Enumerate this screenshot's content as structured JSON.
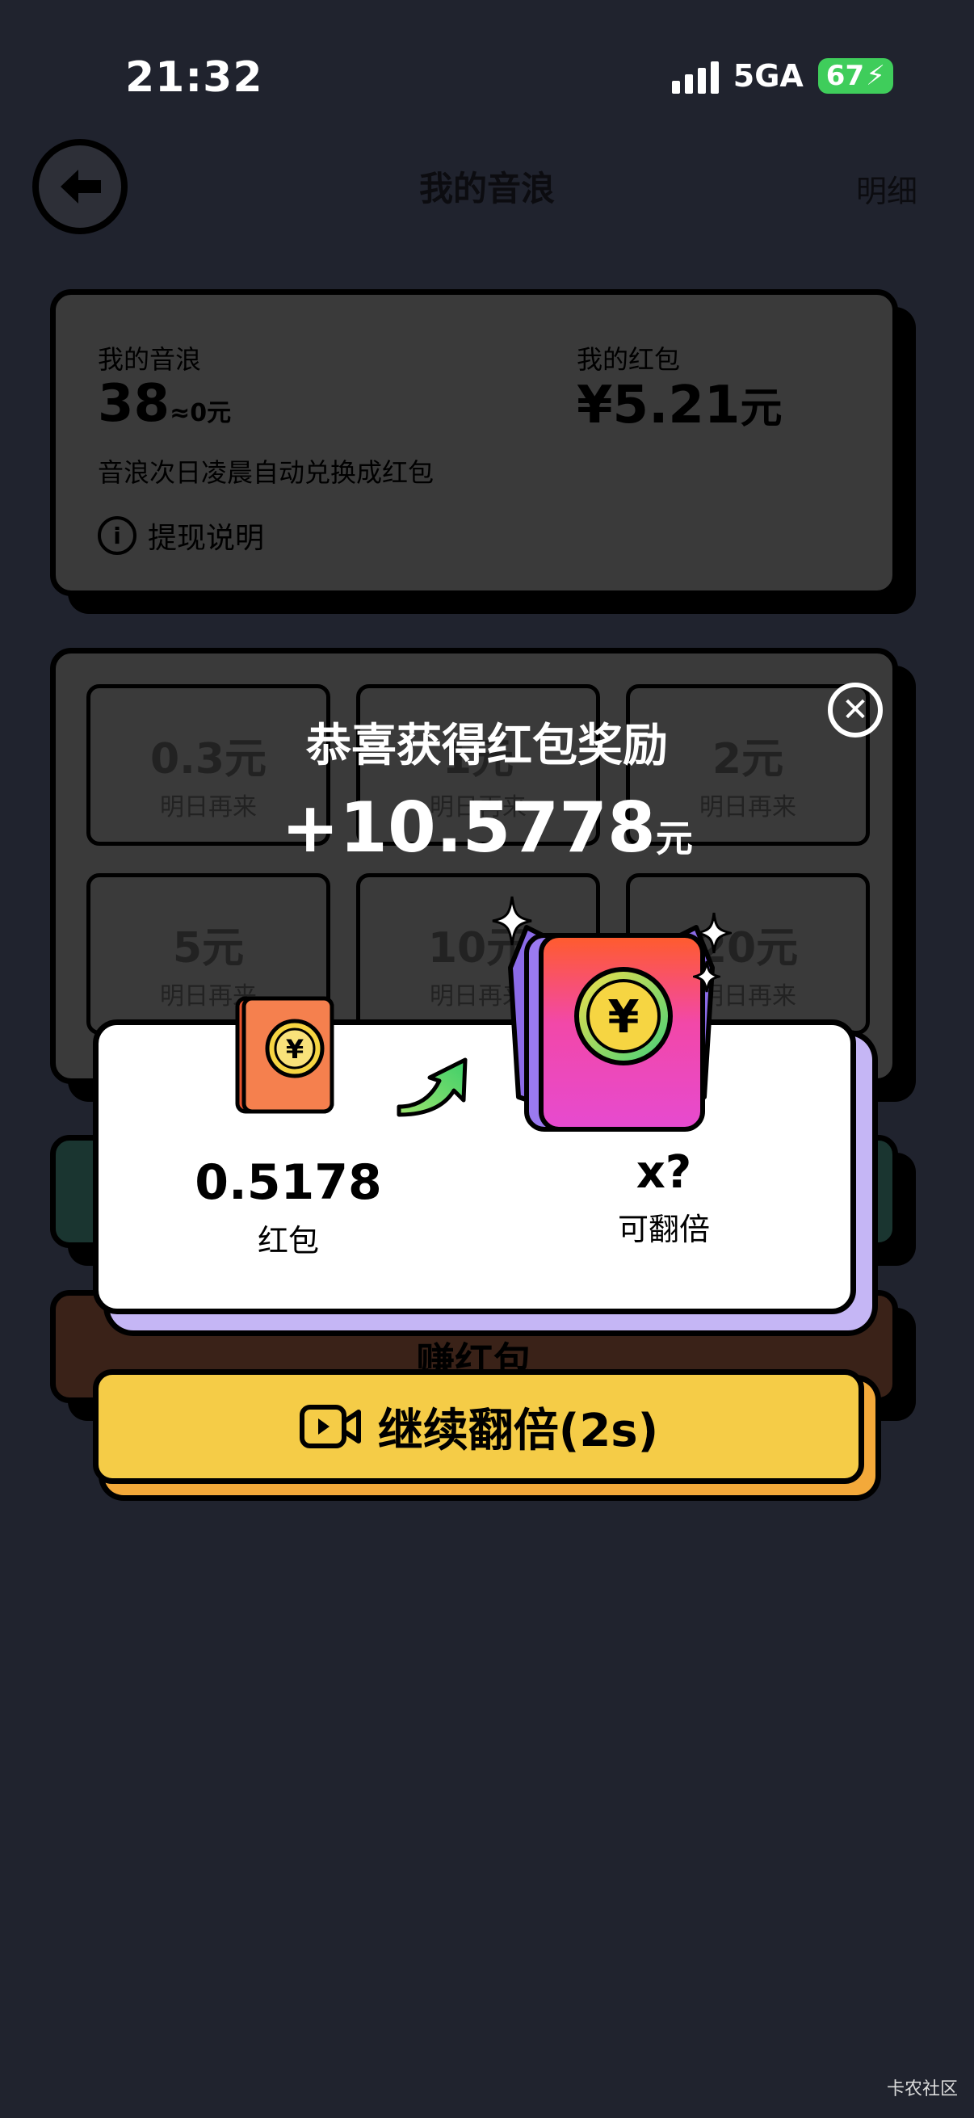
{
  "status": {
    "time": "21:32",
    "network": "5GA",
    "battery": "67"
  },
  "header": {
    "title": "我的音浪",
    "detail": "明细"
  },
  "wallet": {
    "sound_wave_label": "我的音浪",
    "sound_wave_value": "38",
    "sound_wave_equiv": "≈0元",
    "red_packet_label": "我的红包",
    "red_packet_value": "¥5.21",
    "red_packet_unit": "元",
    "note": "音浪次日凌晨自动兑换成红包",
    "withdraw_info": "提现说明"
  },
  "grid": [
    {
      "value": "0.3元",
      "status": "明日再来"
    },
    {
      "value": "1元",
      "status": "明日再来"
    },
    {
      "value": "2元",
      "status": "明日再来"
    },
    {
      "value": "5元",
      "status": "明日再来"
    },
    {
      "value": "10元",
      "status": "明日再来"
    },
    {
      "value": "20元",
      "status": "明日再来"
    }
  ],
  "earn": {
    "label": "赚红包"
  },
  "reward": {
    "title": "恭喜获得红包奖励",
    "amount": "+10.5778",
    "unit": "元",
    "left_amount": "0.5178",
    "left_label": "红包",
    "right_multiplier": "x?",
    "right_label": "可翻倍"
  },
  "continue_button": {
    "label": "继续翻倍(2s)"
  },
  "watermark": "卡农社区",
  "colors": {
    "background": "#20232e",
    "button": "#f5cc47",
    "card_shadow": "#c5b6f5",
    "battery": "#3fcd5b"
  }
}
